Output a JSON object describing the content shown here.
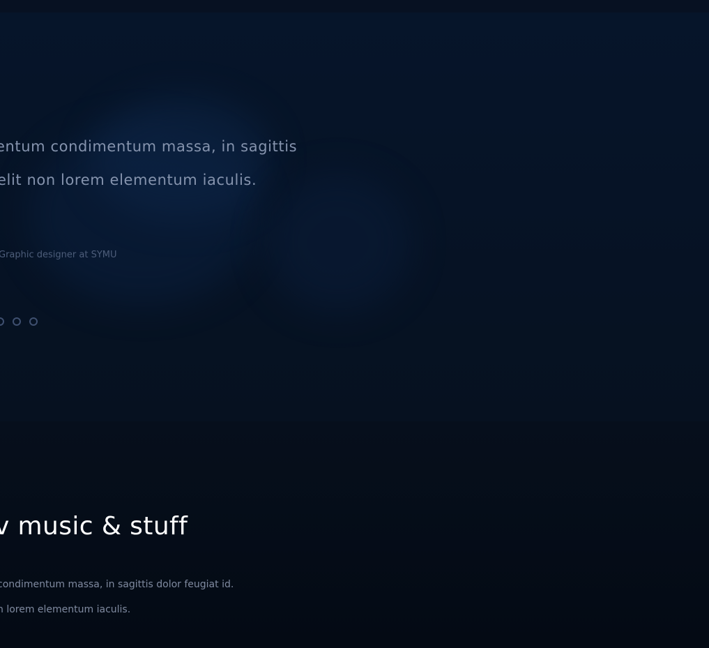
{
  "testimonial": {
    "quote_line_1": "entum condimentum massa, in sagittis",
    "quote_line_2": "elit non lorem elementum iaculis.",
    "author": "Graphic designer at SYMU",
    "dots_count": 3
  },
  "music": {
    "title": "v music & stuff",
    "text_line_1": "condimentum massa, in sagittis dolor feugiat id.",
    "text_line_2": "n lorem elementum iaculis."
  },
  "colors": {
    "background_dark": "#050b16",
    "testimonial_bg": "#06152a",
    "quote_text": "#8593ad",
    "muted_text": "#4d5d7a",
    "title_text": "#ffffff"
  }
}
